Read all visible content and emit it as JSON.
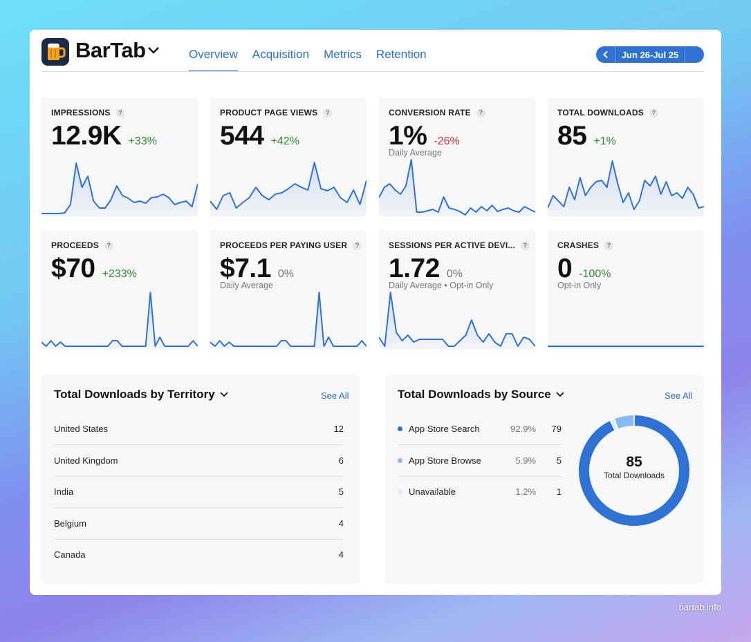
{
  "app": {
    "title": "BarTab"
  },
  "tabs": [
    {
      "label": "Overview",
      "active": true
    },
    {
      "label": "Acquisition",
      "active": false
    },
    {
      "label": "Metrics",
      "active": false
    },
    {
      "label": "Retention",
      "active": false
    }
  ],
  "date_range": {
    "label": "Jun 26-Jul 25"
  },
  "help_glyph": "?",
  "metrics": [
    {
      "label": "IMPRESSIONS",
      "value": "12.9K",
      "change": "+33%",
      "trend": "pos",
      "sub": "",
      "spark": [
        2,
        2,
        2,
        2,
        3,
        15,
        75,
        40,
        56,
        20,
        10,
        10,
        22,
        42,
        28,
        24,
        18,
        20,
        17,
        25,
        26,
        30,
        25,
        15,
        18,
        20,
        12,
        45
      ]
    },
    {
      "label": "PRODUCT PAGE VIEWS",
      "value": "544",
      "change": "+42%",
      "trend": "pos",
      "sub": "",
      "spark": [
        20,
        8,
        28,
        32,
        10,
        18,
        25,
        40,
        28,
        22,
        30,
        32,
        38,
        45,
        40,
        36,
        76,
        38,
        35,
        40,
        25,
        18,
        36,
        15,
        50
      ]
    },
    {
      "label": "CONVERSION RATE",
      "value": "1%",
      "change": "-26%",
      "trend": "neg",
      "sub": "Daily Average",
      "spark": [
        25,
        40,
        45,
        36,
        30,
        42,
        80,
        4,
        4,
        6,
        8,
        4,
        26,
        10,
        8,
        5,
        0,
        10,
        4,
        12,
        6,
        14,
        5,
        8,
        10,
        6,
        4,
        12,
        8,
        4
      ]
    },
    {
      "label": "TOTAL DOWNLOADS",
      "value": "85",
      "change": "+1%",
      "trend": "pos",
      "sub": "",
      "spark": [
        10,
        28,
        20,
        12,
        40,
        22,
        54,
        28,
        40,
        48,
        50,
        40,
        78,
        45,
        18,
        32,
        8,
        20,
        50,
        42,
        56,
        30,
        48,
        28,
        32,
        24,
        40,
        30,
        10,
        12
      ]
    },
    {
      "label": "PROCEEDS",
      "value": "$70",
      "change": "+233%",
      "trend": "pos",
      "sub": "",
      "spark": [
        8,
        2,
        10,
        2,
        8,
        2,
        2,
        2,
        2,
        2,
        2,
        2,
        2,
        2,
        2,
        10,
        10,
        2,
        2,
        2,
        2,
        2,
        2,
        80,
        2,
        15,
        2,
        2,
        2,
        2,
        2,
        2,
        10,
        2
      ]
    },
    {
      "label": "PROCEEDS PER PAYING USER",
      "value": "$7.1",
      "change": "0%",
      "trend": "flat",
      "sub": "Daily Average",
      "spark": [
        8,
        2,
        10,
        2,
        8,
        2,
        2,
        2,
        2,
        2,
        2,
        2,
        2,
        2,
        2,
        10,
        10,
        2,
        2,
        2,
        2,
        2,
        2,
        80,
        2,
        15,
        2,
        2,
        2,
        2,
        2,
        2,
        10,
        2
      ]
    },
    {
      "label": "SESSIONS PER ACTIVE DEVI...",
      "value": "1.72",
      "change": "0%",
      "trend": "flat",
      "sub": "Daily Average • Opt-in Only",
      "spark": [
        15,
        2,
        80,
        22,
        10,
        18,
        8,
        12,
        12,
        12,
        12,
        12,
        2,
        2,
        10,
        18,
        40,
        18,
        8,
        20,
        8,
        2,
        20,
        20,
        2,
        15,
        12,
        2
      ]
    },
    {
      "label": "CRASHES",
      "value": "0",
      "change": "-100%",
      "trend": "pos",
      "sub": "Opt-in Only",
      "spark": [
        2,
        2,
        2,
        2,
        2,
        2,
        2,
        2,
        2,
        2
      ]
    }
  ],
  "territory": {
    "title": "Total Downloads by Territory",
    "see_all": "See All",
    "rows": [
      {
        "name": "United States",
        "count": "12"
      },
      {
        "name": "United Kingdom",
        "count": "6"
      },
      {
        "name": "India",
        "count": "5"
      },
      {
        "name": "Belgium",
        "count": "4"
      },
      {
        "name": "Canada",
        "count": "4"
      }
    ]
  },
  "source": {
    "title": "Total Downloads by Source",
    "see_all": "See All",
    "rows": [
      {
        "name": "App Store Search",
        "pct": "92.9%",
        "count": "79",
        "color": "#2f72d4",
        "value": 79
      },
      {
        "name": "App Store Browse",
        "pct": "5.9%",
        "count": "5",
        "color": "#8ab8f3",
        "value": 5
      },
      {
        "name": "Unavailable",
        "pct": "1.2%",
        "count": "1",
        "color": "#dbe9fb",
        "value": 1
      }
    ],
    "total_value": "85",
    "total_label": "Total Downloads"
  },
  "footer": {
    "url": "bartab.info"
  }
}
